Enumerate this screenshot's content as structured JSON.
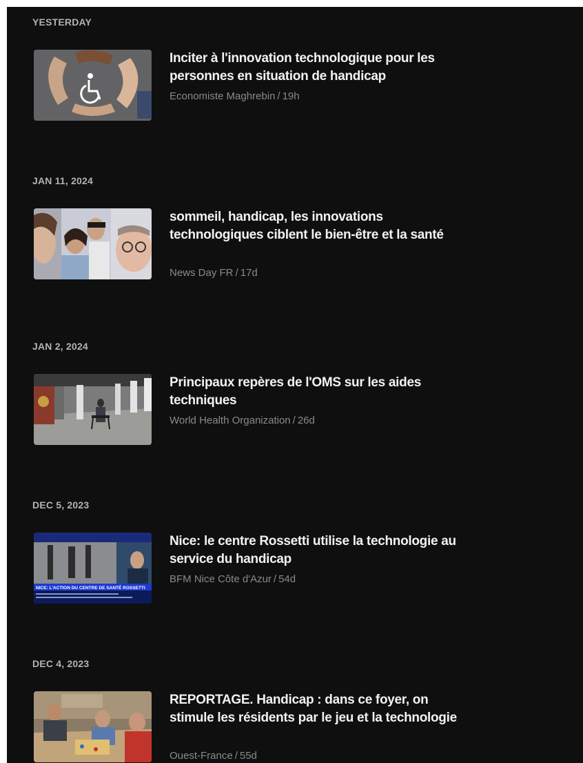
{
  "groups": [
    {
      "date": "YESTERDAY",
      "article": {
        "title": "Inciter à l'innovation technologique pour les personnes en situation de handicap",
        "source": "Economiste Maghrebin",
        "age": "19h",
        "thumbnail": "hands-wheelchair-icon"
      }
    },
    {
      "date": "JAN 11, 2024",
      "article": {
        "title": "sommeil, handicap, les innovations technologiques ciblent le bien-être et la santé",
        "source": "News Day FR",
        "age": "17d",
        "thumbnail": "people-faces-photo"
      }
    },
    {
      "date": "JAN 2, 2024",
      "article": {
        "title": "Principaux repères de l'OMS sur les aides techniques",
        "source": "World Health Organization",
        "age": "26d",
        "thumbnail": "walker-street-photo"
      }
    },
    {
      "date": "DEC 5, 2023",
      "article": {
        "title": "Nice: le centre Rossetti utilise la technologie au service du handicap",
        "source": "BFM Nice Côte d'Azur",
        "age": "54d",
        "thumbnail": "tv-broadcast-photo",
        "thumbnail_caption": "NICE: L'ACTION DU CENTRE DE SANTÉ ROSSETTI"
      }
    },
    {
      "date": "DEC 4, 2023",
      "article": {
        "title": "REPORTAGE. Handicap : dans ce foyer, on stimule les résidents par le jeu et la technologie",
        "source": "Ouest-France",
        "age": "55d",
        "thumbnail": "board-game-photo"
      }
    }
  ],
  "meta_separator": "/",
  "colors": {
    "background": "#0f0f10",
    "title": "#f2f2f2",
    "date_header": "#b3b3b3",
    "meta": "#8a8a8a"
  }
}
